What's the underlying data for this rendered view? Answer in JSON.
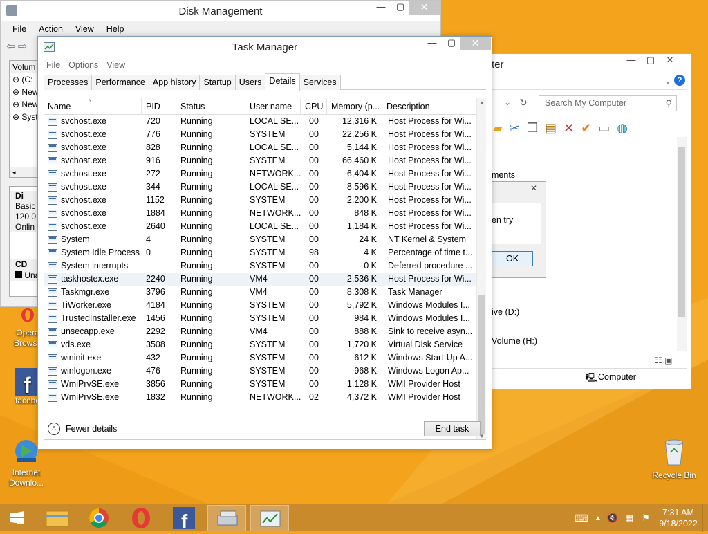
{
  "colors": {
    "desktop": "#f4a41c",
    "taskbar": "#c98a2b",
    "selected_row": "#eef3fa"
  },
  "disk_management": {
    "title": "Disk Management",
    "menu": [
      "File",
      "Action",
      "View",
      "Help"
    ],
    "volume_col": "Volum",
    "volumes": [
      "(C:",
      "New",
      "New",
      "Syst"
    ],
    "disk": {
      "name": "Di",
      "type": "Basic",
      "size": "120.0",
      "status": "Onlin"
    },
    "cd": {
      "name": "CD",
      "label": "Una"
    }
  },
  "task_manager": {
    "title": "Task Manager",
    "menu": [
      "File",
      "Options",
      "View"
    ],
    "tabs": [
      "Processes",
      "Performance",
      "App history",
      "Startup",
      "Users",
      "Details",
      "Services"
    ],
    "active_tab": "Details",
    "columns": {
      "name": "Name",
      "pid": "PID",
      "status": "Status",
      "user": "User name",
      "cpu": "CPU",
      "memory": "Memory (p...",
      "description": "Description"
    },
    "rows": [
      {
        "name": "svchost.exe",
        "pid": "720",
        "status": "Running",
        "user": "LOCAL SE...",
        "cpu": "00",
        "memory": "12,316 K",
        "description": "Host Process for Wi..."
      },
      {
        "name": "svchost.exe",
        "pid": "776",
        "status": "Running",
        "user": "SYSTEM",
        "cpu": "00",
        "memory": "22,256 K",
        "description": "Host Process for Wi..."
      },
      {
        "name": "svchost.exe",
        "pid": "828",
        "status": "Running",
        "user": "LOCAL SE...",
        "cpu": "00",
        "memory": "5,144 K",
        "description": "Host Process for Wi..."
      },
      {
        "name": "svchost.exe",
        "pid": "916",
        "status": "Running",
        "user": "SYSTEM",
        "cpu": "00",
        "memory": "66,460 K",
        "description": "Host Process for Wi..."
      },
      {
        "name": "svchost.exe",
        "pid": "272",
        "status": "Running",
        "user": "NETWORK...",
        "cpu": "00",
        "memory": "6,404 K",
        "description": "Host Process for Wi..."
      },
      {
        "name": "svchost.exe",
        "pid": "344",
        "status": "Running",
        "user": "LOCAL SE...",
        "cpu": "00",
        "memory": "8,596 K",
        "description": "Host Process for Wi..."
      },
      {
        "name": "svchost.exe",
        "pid": "1152",
        "status": "Running",
        "user": "SYSTEM",
        "cpu": "00",
        "memory": "2,200 K",
        "description": "Host Process for Wi..."
      },
      {
        "name": "svchost.exe",
        "pid": "1884",
        "status": "Running",
        "user": "NETWORK...",
        "cpu": "00",
        "memory": "848 K",
        "description": "Host Process for Wi..."
      },
      {
        "name": "svchost.exe",
        "pid": "2640",
        "status": "Running",
        "user": "LOCAL SE...",
        "cpu": "00",
        "memory": "1,184 K",
        "description": "Host Process for Wi..."
      },
      {
        "name": "System",
        "pid": "4",
        "status": "Running",
        "user": "SYSTEM",
        "cpu": "00",
        "memory": "24 K",
        "description": "NT Kernel & System"
      },
      {
        "name": "System Idle Process",
        "pid": "0",
        "status": "Running",
        "user": "SYSTEM",
        "cpu": "98",
        "memory": "4 K",
        "description": "Percentage of time t..."
      },
      {
        "name": "System interrupts",
        "pid": "-",
        "status": "Running",
        "user": "SYSTEM",
        "cpu": "00",
        "memory": "0 K",
        "description": "Deferred procedure ..."
      },
      {
        "name": "taskhostex.exe",
        "pid": "2240",
        "status": "Running",
        "user": "VM4",
        "cpu": "00",
        "memory": "2,536 K",
        "description": "Host Process for Wi...",
        "selected": true
      },
      {
        "name": "Taskmgr.exe",
        "pid": "3796",
        "status": "Running",
        "user": "VM4",
        "cpu": "00",
        "memory": "8,308 K",
        "description": "Task Manager"
      },
      {
        "name": "TiWorker.exe",
        "pid": "4184",
        "status": "Running",
        "user": "SYSTEM",
        "cpu": "00",
        "memory": "5,792 K",
        "description": "Windows Modules I..."
      },
      {
        "name": "TrustedInstaller.exe",
        "pid": "1456",
        "status": "Running",
        "user": "SYSTEM",
        "cpu": "00",
        "memory": "984 K",
        "description": "Windows Modules I..."
      },
      {
        "name": "unsecapp.exe",
        "pid": "2292",
        "status": "Running",
        "user": "VM4",
        "cpu": "00",
        "memory": "888 K",
        "description": "Sink to receive asyn..."
      },
      {
        "name": "vds.exe",
        "pid": "3508",
        "status": "Running",
        "user": "SYSTEM",
        "cpu": "00",
        "memory": "1,720 K",
        "description": "Virtual Disk Service"
      },
      {
        "name": "wininit.exe",
        "pid": "432",
        "status": "Running",
        "user": "SYSTEM",
        "cpu": "00",
        "memory": "612 K",
        "description": "Windows Start-Up A..."
      },
      {
        "name": "winlogon.exe",
        "pid": "476",
        "status": "Running",
        "user": "SYSTEM",
        "cpu": "00",
        "memory": "968 K",
        "description": "Windows Logon Ap..."
      },
      {
        "name": "WmiPrvSE.exe",
        "pid": "3856",
        "status": "Running",
        "user": "SYSTEM",
        "cpu": "00",
        "memory": "1,128 K",
        "description": "WMI Provider Host"
      },
      {
        "name": "WmiPrvSE.exe",
        "pid": "1832",
        "status": "Running",
        "user": "NETWORK...",
        "cpu": "02",
        "memory": "4,372 K",
        "description": "WMI Provider Host"
      }
    ],
    "fewer_details": "Fewer details",
    "end_task": "End task"
  },
  "computer_window": {
    "title_fragment": "ter",
    "search_placeholder": "Search My Computer",
    "section_fragment": "ments",
    "dialog_text": "en try",
    "dialog_ok": "OK",
    "drive_fragment": "ive (D:)",
    "volume_fragment": "Volume (H:)",
    "status_label": "Computer"
  },
  "desktop_icons": [
    {
      "label": "Opera Browser",
      "short": "Opera\nBrowse",
      "icon": "opera-icon"
    },
    {
      "label": "facebook",
      "short": "facebo",
      "icon": "facebook-icon"
    },
    {
      "label": "Internet Downlo...",
      "short": "Internet\nDownlo...",
      "icon": "download-manager-icon"
    },
    {
      "label": "Recycle Bin",
      "short": "Recycle Bin",
      "icon": "recycle-bin-icon"
    }
  ],
  "taskbar": {
    "apps": [
      "start-icon",
      "file-explorer-icon",
      "chrome-icon",
      "opera-icon",
      "facebook-icon",
      "disk-management-icon",
      "task-manager-icon"
    ],
    "time": "7:31 AM",
    "date": "9/18/2022"
  }
}
